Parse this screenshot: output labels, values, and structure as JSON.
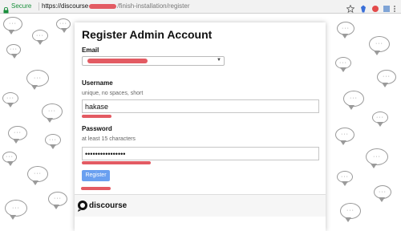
{
  "browser": {
    "secure_label": "Secure",
    "url_host": "https://discourse",
    "url_path": "/finish-installation/register"
  },
  "form": {
    "title": "Register Admin Account",
    "email": {
      "label": "Email"
    },
    "username": {
      "label": "Username",
      "hint": "unique, no spaces, short",
      "value": "hakase"
    },
    "password": {
      "label": "Password",
      "hint": "at least 15 characters",
      "value": "••••••••••••••••"
    },
    "submit_label": "Register"
  },
  "footer": {
    "logo_text": "discourse"
  },
  "colors": {
    "accent": "#6aa0f0",
    "redaction": "#e35b63",
    "secure": "#1a8f3c"
  }
}
